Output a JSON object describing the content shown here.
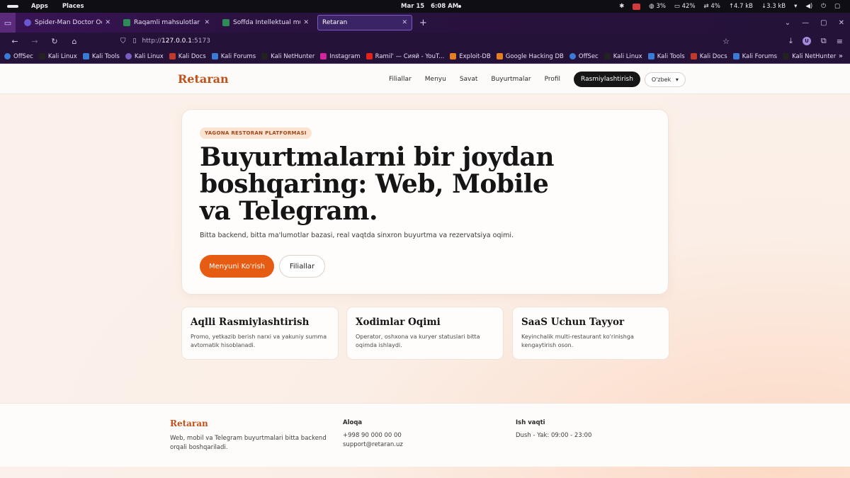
{
  "system_bar": {
    "menu_apps": "Apps",
    "menu_places": "Places",
    "date": "Mar 15",
    "time": "6:08 AM",
    "cpu": "3%",
    "battery": "42%",
    "swap": "4%",
    "net_up": "4.7 kB",
    "net_down": "3.3 kB"
  },
  "tabs": [
    {
      "title": "Spider-Man Doctor Octop",
      "fav_color": "#6a5acd"
    },
    {
      "title": "Raqamli mahsulotlar va o",
      "fav_color": "#2e8b57"
    },
    {
      "title": "Soffda Intellektual mulkla",
      "fav_color": "#2e8b57"
    },
    {
      "title": "Retaran",
      "fav_color": ""
    }
  ],
  "address_bar": {
    "url_prefix": "http://",
    "url_host": "127.0.0.1",
    "url_port": ":5173"
  },
  "bookmarks": [
    {
      "label": "OffSec",
      "color": "#3a7bd5"
    },
    {
      "label": "Kali Linux",
      "color": "#222"
    },
    {
      "label": "Kali Tools",
      "color": "#3a7bd5"
    },
    {
      "label": "Kali Linux",
      "color": "#7a5cc2"
    },
    {
      "label": "Kali Docs",
      "color": "#c0392b"
    },
    {
      "label": "Kali Forums",
      "color": "#3a7bd5"
    },
    {
      "label": "Kali NetHunter",
      "color": "#222"
    },
    {
      "label": "Instagram",
      "color": "#d6249f"
    },
    {
      "label": "Ramil' — Сияй - YouT...",
      "color": "#e62117"
    },
    {
      "label": "Exploit-DB",
      "color": "#e67e22"
    },
    {
      "label": "Google Hacking DB",
      "color": "#e67e22"
    },
    {
      "label": "OffSec",
      "color": "#3a7bd5"
    },
    {
      "label": "Kali Linux",
      "color": "#222"
    },
    {
      "label": "Kali Tools",
      "color": "#3a7bd5"
    },
    {
      "label": "Kali Docs",
      "color": "#c0392b"
    },
    {
      "label": "Kali Forums",
      "color": "#3a7bd5"
    },
    {
      "label": "Kali NetHunter",
      "color": "#222"
    }
  ],
  "site": {
    "logo": "Retaran",
    "nav": [
      "Filiallar",
      "Menyu",
      "Savat",
      "Buyurtmalar",
      "Profil"
    ],
    "cta": "Rasmiylashtirish",
    "language": "O'zbek"
  },
  "hero": {
    "badge": "YAGONA RESTORAN PLATFORMASI",
    "title": "Buyurtmalarni bir joydan boshqaring: Web, Mobile va Telegram.",
    "subtitle": "Bitta backend, bitta ma'lumotlar bazasi, real vaqtda sinxron buyurtma va rezervatsiya oqimi.",
    "primary_button": "Menyuni Ko'rish",
    "secondary_button": "Filiallar"
  },
  "features": [
    {
      "title": "Aqlli Rasmiylashtirish",
      "desc": "Promo, yetkazib berish narxi va yakuniy summa avtomatik hisoblanadi."
    },
    {
      "title": "Xodimlar Oqimi",
      "desc": "Operator, oshxona va kuryer statuslari bitta oqimda ishlaydi."
    },
    {
      "title": "SaaS Uchun Tayyor",
      "desc": "Keyinchalik multi-restaurant ko'rinishga kengaytirish oson."
    }
  ],
  "footer": {
    "logo": "Retaran",
    "description": "Web, mobil va Telegram buyurtmalari bitta backend orqali boshqariladi.",
    "contact_heading": "Aloqa",
    "phone": "+998 90 000 00 00",
    "email": "support@retaran.uz",
    "hours_heading": "Ish vaqti",
    "hours": "Dush - Yak: 09:00 - 23:00"
  }
}
